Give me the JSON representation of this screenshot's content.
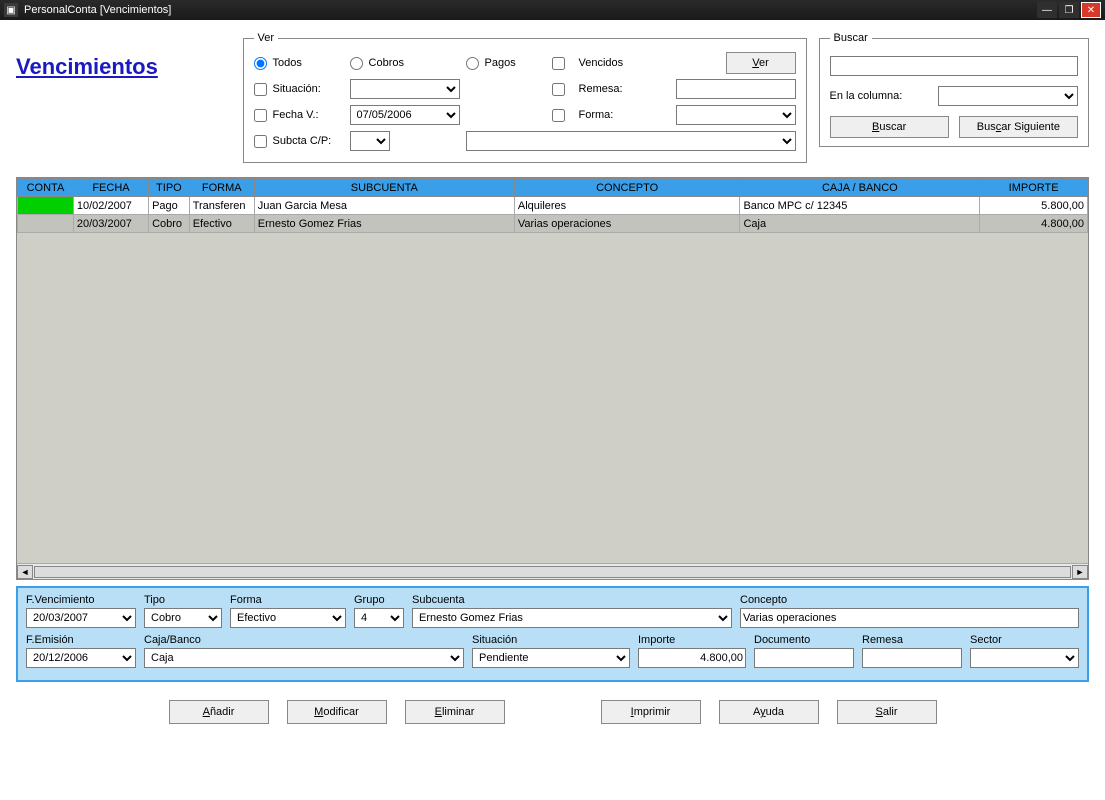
{
  "window": {
    "title": "PersonalConta [Vencimientos]"
  },
  "page": {
    "title": "Vencimientos"
  },
  "ver": {
    "legend": "Ver",
    "opt_todos": "Todos",
    "opt_cobros": "Cobros",
    "opt_pagos": "Pagos",
    "chk_vencidos": "Vencidos",
    "btn_ver": "Ver",
    "chk_situacion": "Situación:",
    "chk_remesa": "Remesa:",
    "chk_fecha": "Fecha V.:",
    "fecha_value": "07/05/2006",
    "chk_forma": "Forma:",
    "chk_subcta": "Subcta C/P:"
  },
  "buscar": {
    "legend": "Buscar",
    "col_label": "En la columna:",
    "btn_buscar": "Buscar",
    "btn_siguiente": "Buscar Siguiente"
  },
  "grid": {
    "headers": {
      "conta": "CONTA",
      "fecha": "FECHA",
      "tipo": "TIPO",
      "forma": "FORMA",
      "subcuenta": "SUBCUENTA",
      "concepto": "CONCEPTO",
      "caja": "CAJA / BANCO",
      "importe": "IMPORTE"
    },
    "rows": [
      {
        "conta_green": true,
        "fecha": "10/02/2007",
        "tipo": "Pago",
        "forma": "Transferen",
        "subcuenta": "Juan Garcia Mesa",
        "concepto": "Alquileres",
        "caja": "Banco MPC c/ 12345",
        "importe": "5.800,00"
      },
      {
        "conta_green": false,
        "fecha": "20/03/2007",
        "tipo": "Cobro",
        "forma": "Efectivo",
        "subcuenta": "Ernesto Gomez Frias",
        "concepto": "Varias operaciones",
        "caja": "Caja",
        "importe": "4.800,00"
      }
    ]
  },
  "detail": {
    "labels": {
      "fvenc": "F.Vencimiento",
      "tipo": "Tipo",
      "forma": "Forma",
      "grupo": "Grupo",
      "subcuenta": "Subcuenta",
      "concepto": "Concepto",
      "femision": "F.Emisión",
      "caja": "Caja/Banco",
      "situacion": "Situación",
      "importe": "Importe",
      "documento": "Documento",
      "remesa": "Remesa",
      "sector": "Sector"
    },
    "values": {
      "fvenc": "20/03/2007",
      "tipo": "Cobro",
      "forma": "Efectivo",
      "grupo": "4",
      "subcuenta": "Ernesto Gomez Frias",
      "concepto": "Varias operaciones",
      "femision": "20/12/2006",
      "caja": "Caja",
      "situacion": "Pendiente",
      "importe": "4.800,00",
      "documento": "",
      "remesa": "",
      "sector": ""
    }
  },
  "buttons": {
    "anadir": "Añadir",
    "modificar": "Modificar",
    "eliminar": "Eliminar",
    "imprimir": "Imprimir",
    "ayuda": "Ayuda",
    "salir": "Salir"
  }
}
